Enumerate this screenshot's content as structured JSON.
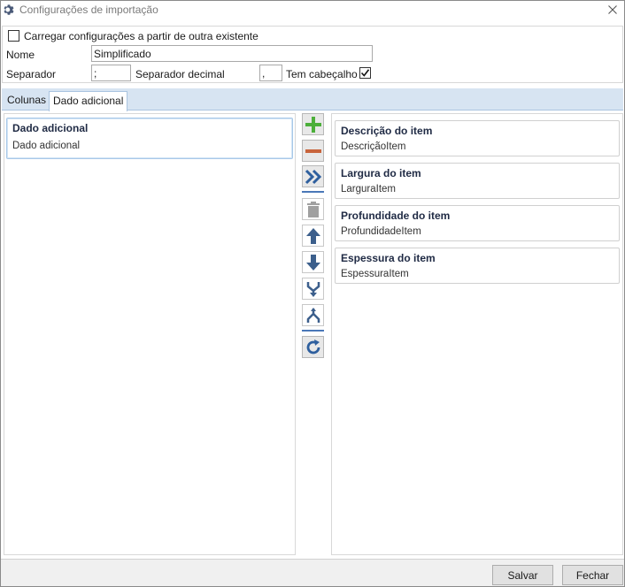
{
  "window": {
    "title": "Configurações de importação",
    "icon": "gear-icon",
    "close_icon": "close-icon"
  },
  "settings": {
    "load_existing_label": "Carregar configurações a partir de outra existente",
    "load_existing_checked": false,
    "name_label": "Nome",
    "name_value": "Simplificado",
    "separator_label": "Separador",
    "separator_value": ";",
    "decimal_separator_label": "Separador decimal",
    "decimal_separator_value": ",",
    "has_header_label": "Tem cabeçalho",
    "has_header_checked": true
  },
  "tabs": [
    {
      "label": "Colunas",
      "active": false
    },
    {
      "label": "Dado adicional",
      "active": true
    }
  ],
  "left_list": [
    {
      "title": "Dado adicional",
      "subtitle": "Dado adicional",
      "selected": true
    }
  ],
  "toolbar": [
    {
      "icon": "plus-icon",
      "color": "#4caf3a"
    },
    {
      "icon": "minus-icon",
      "color": "#c8643c"
    },
    {
      "icon": "double-chevron-right-icon",
      "color": "#2e5f9e"
    },
    {
      "icon": "trash-icon",
      "color": "#a0a0a0"
    },
    {
      "icon": "arrow-up-icon",
      "color": "#3c5f8c"
    },
    {
      "icon": "arrow-down-icon",
      "color": "#3c5f8c"
    },
    {
      "icon": "merge-icon",
      "color": "#3c5f8c"
    },
    {
      "icon": "split-icon",
      "color": "#3c5f8c"
    },
    {
      "icon": "refresh-icon",
      "color": "#2e5f9e"
    }
  ],
  "right_list": [
    {
      "title": "Descrição do item",
      "subtitle": "DescriçãoItem"
    },
    {
      "title": "Largura do item",
      "subtitle": "LarguraItem"
    },
    {
      "title": "Profundidade do item",
      "subtitle": "ProfundidadeItem"
    },
    {
      "title": "Espessura do item",
      "subtitle": "EspessuraItem"
    }
  ],
  "footer": {
    "save_label": "Salvar",
    "close_label": "Fechar"
  },
  "colors": {
    "tab_strip": "#d7e4f2",
    "accent": "#4a78b8",
    "card_title": "#1f2a44"
  }
}
